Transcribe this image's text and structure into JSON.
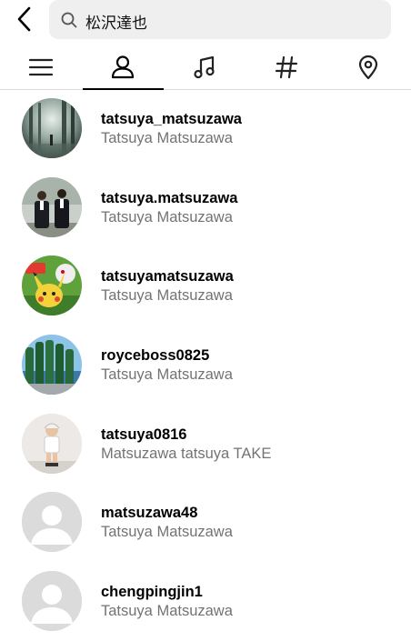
{
  "search": {
    "query": "松沢達也"
  },
  "tabs": [
    {
      "name": "top-tab",
      "icon": "menu-icon",
      "active": false
    },
    {
      "name": "accounts-tab",
      "icon": "person-icon",
      "active": true
    },
    {
      "name": "audio-tab",
      "icon": "music-note-icon",
      "active": false
    },
    {
      "name": "tags-tab",
      "icon": "hashtag-icon",
      "active": false
    },
    {
      "name": "places-tab",
      "icon": "location-pin-icon",
      "active": false
    }
  ],
  "results": [
    {
      "username": "tatsuya_matsuzawa",
      "full_name": "Tatsuya Matsuzawa",
      "avatar": "forest-photo"
    },
    {
      "username": "tatsuya.matsuzawa",
      "full_name": "Tatsuya Matsuzawa",
      "avatar": "two-people-photo"
    },
    {
      "username": "tatsuyamatsuzawa",
      "full_name": "Tatsuya Matsuzawa",
      "avatar": "pikachu-photo"
    },
    {
      "username": "royceboss0825",
      "full_name": "Tatsuya Matsuzawa",
      "avatar": "bottles-photo"
    },
    {
      "username": "tatsuya0816",
      "full_name": "Matsuzawa tatsuya TAKE",
      "avatar": "child-photo"
    },
    {
      "username": "matsuzawa48",
      "full_name": "Tatsuya Matsuzawa",
      "avatar": "default-avatar"
    },
    {
      "username": "chengpingjin1",
      "full_name": "Tatsuya Matsuzawa",
      "avatar": "default-avatar"
    }
  ]
}
